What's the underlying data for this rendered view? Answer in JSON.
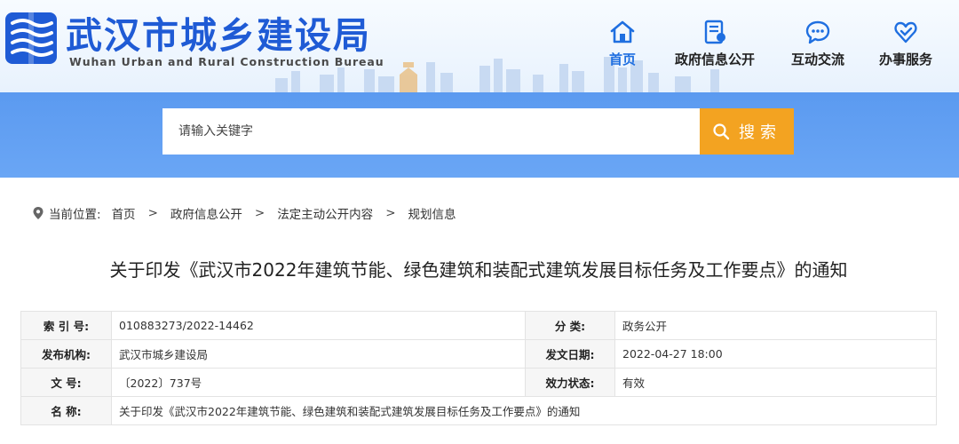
{
  "header": {
    "title": "武汉市城乡建设局",
    "subtitle": "Wuhan Urban and Rural Construction Bureau",
    "brand_color": "#1f5bd5",
    "nav": [
      {
        "label": "首页",
        "icon": "home-icon",
        "active": true
      },
      {
        "label": "政府信息公开",
        "icon": "document-icon",
        "active": false
      },
      {
        "label": "互动交流",
        "icon": "chat-bubble-icon",
        "active": false
      },
      {
        "label": "办事服务",
        "icon": "heart-hand-icon",
        "active": false
      }
    ]
  },
  "search": {
    "placeholder": "请输入关键字",
    "button_label": "搜索",
    "button_icon": "search-icon",
    "button_color": "#f3a321"
  },
  "breadcrumb": {
    "prefix": "当前位置:",
    "items": [
      "首页",
      "政府信息公开",
      "法定主动公开内容",
      "规划信息"
    ]
  },
  "document": {
    "title": "关于印发《武汉市2022年建筑节能、绿色建筑和装配式建筑发展目标任务及工作要点》的通知"
  },
  "meta": {
    "index_label": "索 引 号:",
    "index_value": "010883273/2022-14462",
    "category_label": "分    类:",
    "category_value": "政务公开",
    "issuer_label": "发布机构:",
    "issuer_value": "武汉市城乡建设局",
    "date_label": "发文日期:",
    "date_value": "2022-04-27 18:00",
    "docno_label": "文    号:",
    "docno_value": "〔2022〕737号",
    "status_label": "效力状态:",
    "status_value": "有效",
    "name_label": "名    称:",
    "name_value": "关于印发《武汉市2022年建筑节能、绿色建筑和装配式建筑发展目标任务及工作要点》的通知"
  }
}
